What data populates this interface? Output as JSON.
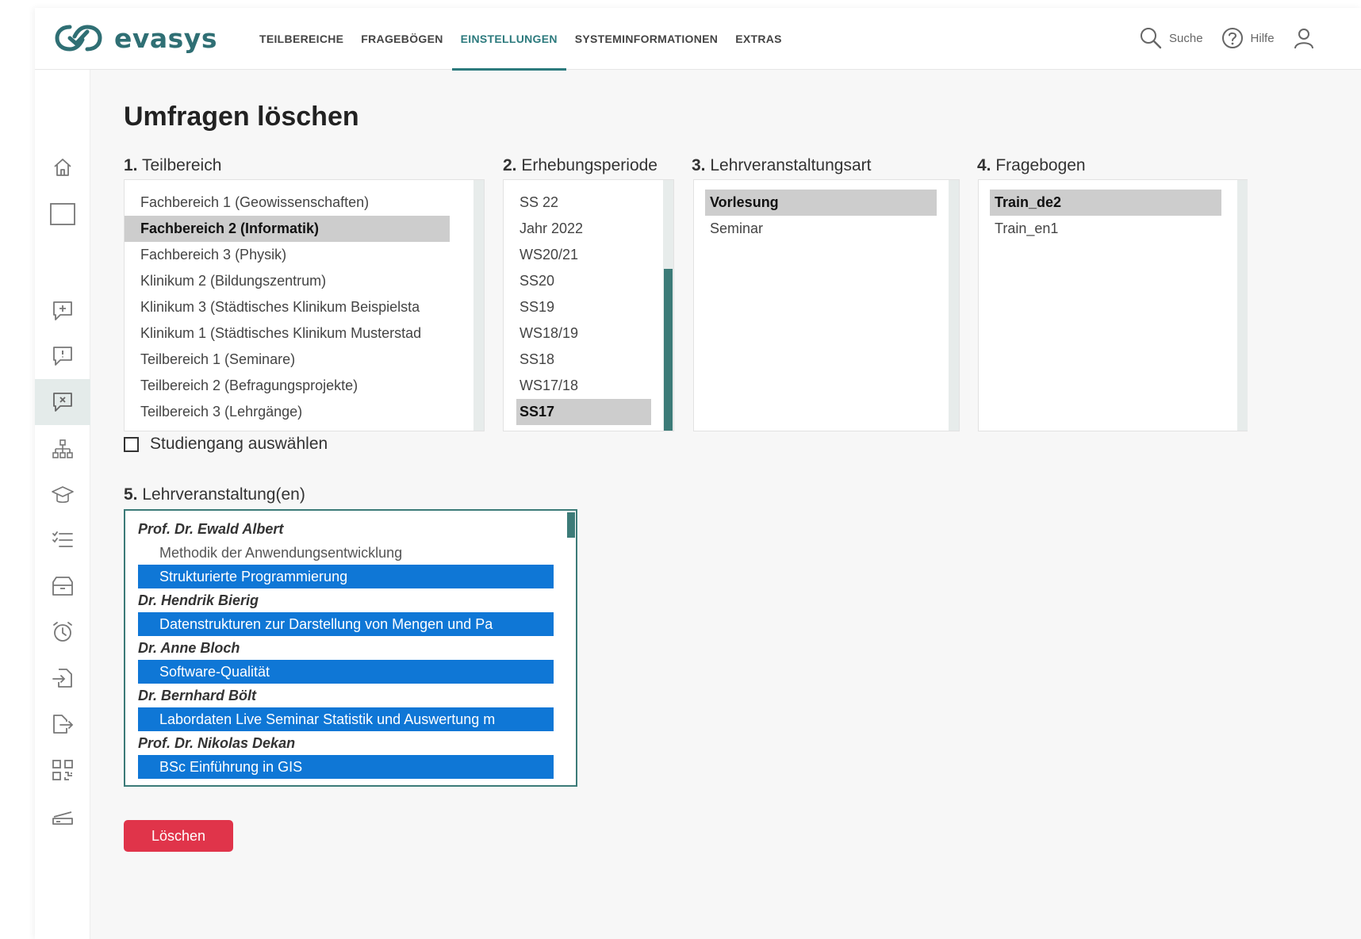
{
  "header": {
    "logo_text": "evasys",
    "nav": [
      {
        "label": "TEILBEREICHE",
        "active": false
      },
      {
        "label": "FRAGEBÖGEN",
        "active": false
      },
      {
        "label": "EINSTELLUNGEN",
        "active": true
      },
      {
        "label": "SYSTEMINFORMATIONEN",
        "active": false
      },
      {
        "label": "EXTRAS",
        "active": false
      }
    ],
    "search_label": "Suche",
    "help_label": "Hilfe"
  },
  "sidebar": {
    "icons": [
      "home-icon",
      "window-icon",
      "survey-add-icon",
      "survey-info-icon",
      "survey-delete-icon",
      "hierarchy-icon",
      "graduation-icon",
      "checklist-icon",
      "archive-icon",
      "alarm-icon",
      "import-icon",
      "export-icon",
      "qr-icon",
      "scanner-icon"
    ],
    "active_icon": "survey-delete-icon"
  },
  "page": {
    "title": "Umfragen löschen"
  },
  "teilbereich": {
    "num": "1.",
    "label": "Teilbereich",
    "options": [
      {
        "text": "Fachbereich 1 (Geowissenschaften)",
        "selected": false
      },
      {
        "text": "Fachbereich 2 (Informatik)",
        "selected": true
      },
      {
        "text": "Fachbereich 3 (Physik)",
        "selected": false
      },
      {
        "text": "Klinikum 2 (Bildungszentrum)",
        "selected": false
      },
      {
        "text": "Klinikum 3 (Städtisches Klinikum Beispielsta",
        "selected": false
      },
      {
        "text": "Klinikum 1 (Städtisches Klinikum Musterstad",
        "selected": false
      },
      {
        "text": "Teilbereich 1 (Seminare)",
        "selected": false
      },
      {
        "text": "Teilbereich 2 (Befragungsprojekte)",
        "selected": false
      },
      {
        "text": "Teilbereich 3 (Lehrgänge)",
        "selected": false
      }
    ]
  },
  "erhebungsperiode": {
    "num": "2.",
    "label": "Erhebungsperiode",
    "options": [
      {
        "text": "SS 22",
        "selected": false
      },
      {
        "text": "Jahr 2022",
        "selected": false
      },
      {
        "text": "WS20/21",
        "selected": false
      },
      {
        "text": "SS20",
        "selected": false
      },
      {
        "text": "SS19",
        "selected": false
      },
      {
        "text": "WS18/19",
        "selected": false
      },
      {
        "text": "SS18",
        "selected": false
      },
      {
        "text": "WS17/18",
        "selected": false
      },
      {
        "text": "SS17",
        "selected": true
      }
    ]
  },
  "lehrveranstaltungsart": {
    "num": "3.",
    "label": "Lehrveranstaltungsart",
    "options": [
      {
        "text": "Vorlesung",
        "selected": true
      },
      {
        "text": "Seminar",
        "selected": false
      }
    ]
  },
  "fragebogen": {
    "num": "4.",
    "label": "Fragebogen",
    "options": [
      {
        "text": "Train_de2",
        "selected": true
      },
      {
        "text": "Train_en1",
        "selected": false
      }
    ]
  },
  "studiengang": {
    "label": "Studiengang auswählen",
    "checked": false
  },
  "lehrveranstaltungen": {
    "num": "5.",
    "label": "Lehrveranstaltung(en)",
    "groups": [
      {
        "name": "Prof. Dr. Ewald Albert",
        "items": [
          {
            "text": "Methodik der Anwendungsentwicklung",
            "selected": false
          },
          {
            "text": "Strukturierte Programmierung",
            "selected": true
          }
        ]
      },
      {
        "name": "Dr. Hendrik Bierig",
        "items": [
          {
            "text": "Datenstrukturen zur Darstellung von Mengen und Pa",
            "selected": true
          }
        ]
      },
      {
        "name": "Dr. Anne Bloch",
        "items": [
          {
            "text": "Software-Qualität",
            "selected": true
          }
        ]
      },
      {
        "name": "Dr. Bernhard Bölt",
        "items": [
          {
            "text": "Labordaten Live Seminar Statistik und Auswertung m",
            "selected": true
          }
        ]
      },
      {
        "name": "Prof. Dr. Nikolas Dekan",
        "items": [
          {
            "text": "BSc Einführung in GIS",
            "selected": true
          }
        ]
      }
    ]
  },
  "actions": {
    "delete_label": "Löschen"
  },
  "colors": {
    "brand": "#2f6f74",
    "accent_teal": "#3c7b78",
    "selection_blue": "#0f77d6",
    "delete_red": "#e0344a"
  }
}
